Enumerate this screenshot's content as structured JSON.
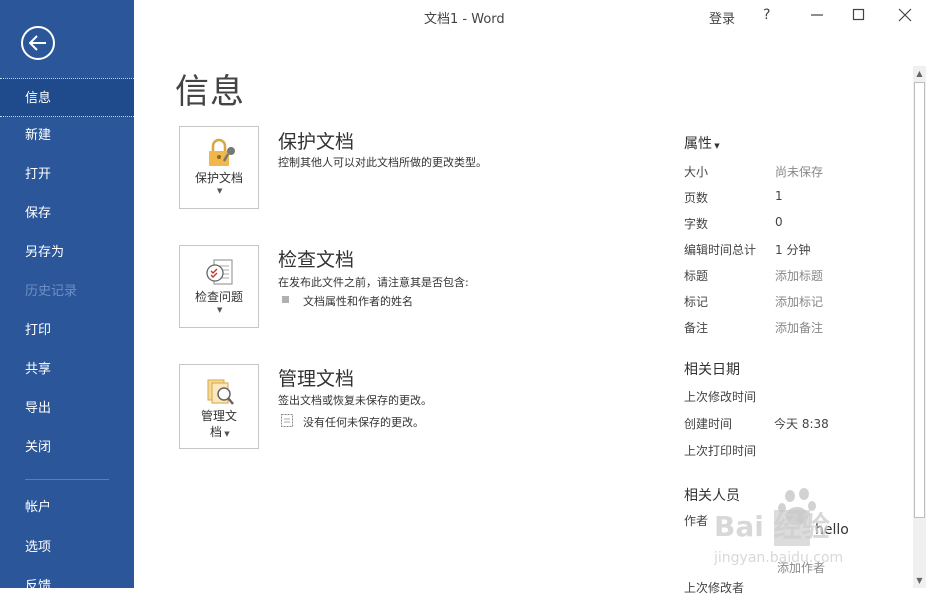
{
  "window": {
    "title": "文档1 - Word",
    "login": "登录",
    "help": "?"
  },
  "sidebar": {
    "items": [
      {
        "label": "信息",
        "state": "active"
      },
      {
        "label": "新建"
      },
      {
        "label": "打开"
      },
      {
        "label": "保存"
      },
      {
        "label": "另存为"
      },
      {
        "label": "历史记录",
        "state": "disabled"
      },
      {
        "label": "打印"
      },
      {
        "label": "共享"
      },
      {
        "label": "导出"
      },
      {
        "label": "关闭"
      },
      {
        "label": "帐户"
      },
      {
        "label": "选项"
      },
      {
        "label": "反馈"
      }
    ]
  },
  "main": {
    "title": "信息",
    "sections": [
      {
        "button_label": "保护文档",
        "title": "保护文档",
        "description": "控制其他人可以对此文档所做的更改类型。"
      },
      {
        "button_label": "检查问题",
        "title": "检查文档",
        "description": "在发布此文件之前，请注意其是否包含:",
        "bullet": "文档属性和作者的姓名"
      },
      {
        "button_label_line1": "管理文",
        "button_label_line2": "档",
        "title": "管理文档",
        "description": "签出文档或恢复未保存的更改。",
        "bullet": "没有任何未保存的更改。"
      }
    ]
  },
  "properties": {
    "header": "属性",
    "rows": [
      {
        "label": "大小",
        "value": "尚未保存"
      },
      {
        "label": "页数",
        "value": "1"
      },
      {
        "label": "字数",
        "value": "0"
      },
      {
        "label": "编辑时间总计",
        "value": "1 分钟"
      },
      {
        "label": "标题",
        "value": "添加标题"
      },
      {
        "label": "标记",
        "value": "添加标记"
      },
      {
        "label": "备注",
        "value": "添加备注"
      }
    ],
    "dates_header": "相关日期",
    "dates": [
      {
        "label": "上次修改时间",
        "value": ""
      },
      {
        "label": "创建时间",
        "value": "今天 8:38"
      },
      {
        "label": "上次打印时间",
        "value": ""
      }
    ],
    "people_header": "相关人员",
    "author_label": "作者",
    "author_name": "hello",
    "add_author": "添加作者",
    "last_modified_by": "上次修改者"
  },
  "watermark": {
    "text": "Bai 经验",
    "url": "jingyan.baidu.com"
  },
  "colors": {
    "sidebar": "#2b579a",
    "sidebar_active": "#1f4a8c"
  }
}
